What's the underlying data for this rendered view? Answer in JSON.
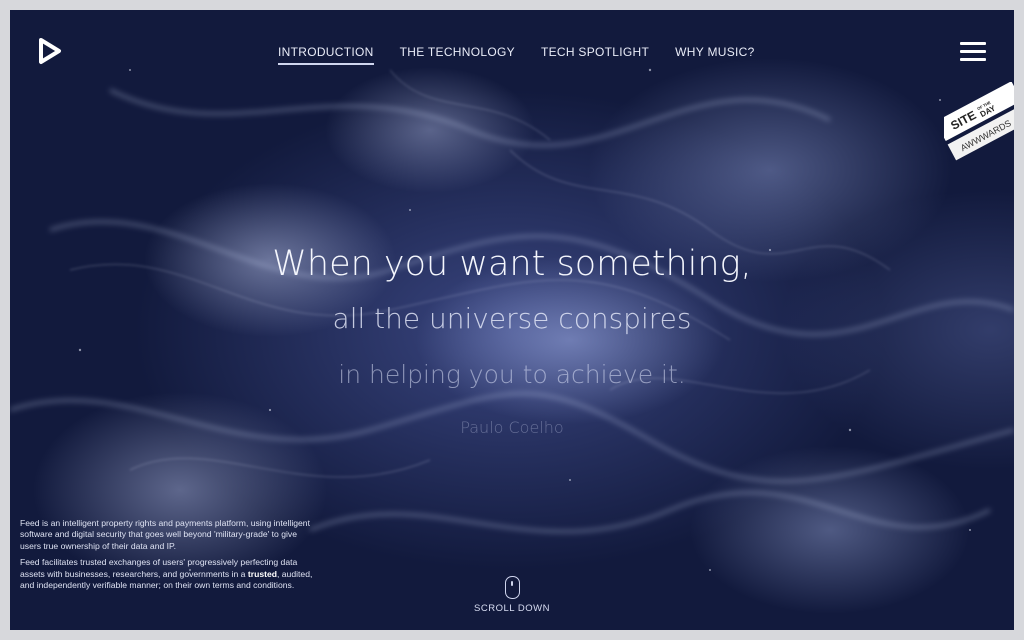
{
  "nav": {
    "items": [
      {
        "label": "INTRODUCTION",
        "active": true
      },
      {
        "label": "THE TECHNOLOGY",
        "active": false
      },
      {
        "label": "TECH SPOTLIGHT",
        "active": false
      },
      {
        "label": "WHY MUSIC?",
        "active": false
      }
    ]
  },
  "icons": {
    "logo": "play-arrow-logo",
    "menu": "hamburger-menu-icon",
    "award": "awwwards-site-of-the-day-ribbon",
    "scroll": "mouse-scroll-icon"
  },
  "award": {
    "line1": "SITE",
    "of_the": "OF THE",
    "line2": "DAY",
    "brand": "AWWWARDS"
  },
  "quote": {
    "line1": "When you want something,",
    "line2": "all the universe conspires",
    "line3": "in helping you to achieve it.",
    "author": "Paulo Coelho"
  },
  "description": {
    "p1": "Feed is an intelligent property rights and payments platform, using intelligent software and digital security that goes well beyond 'military-grade' to give users true ownership of their data and IP.",
    "p2_before": "Feed facilitates trusted exchanges of users' progressively perfecting data assets with businesses, researchers, and governments in a ",
    "p2_bold": "trusted",
    "p2_after": ", audited, and independently verifiable manner; on their own terms and conditions."
  },
  "scroll": {
    "label": "SCROLL DOWN"
  },
  "colors": {
    "background_dark": "#121a3d",
    "background_mid": "#3a4680",
    "text_light": "#f4f6fd",
    "nav_underline": "#cfd5ee"
  }
}
